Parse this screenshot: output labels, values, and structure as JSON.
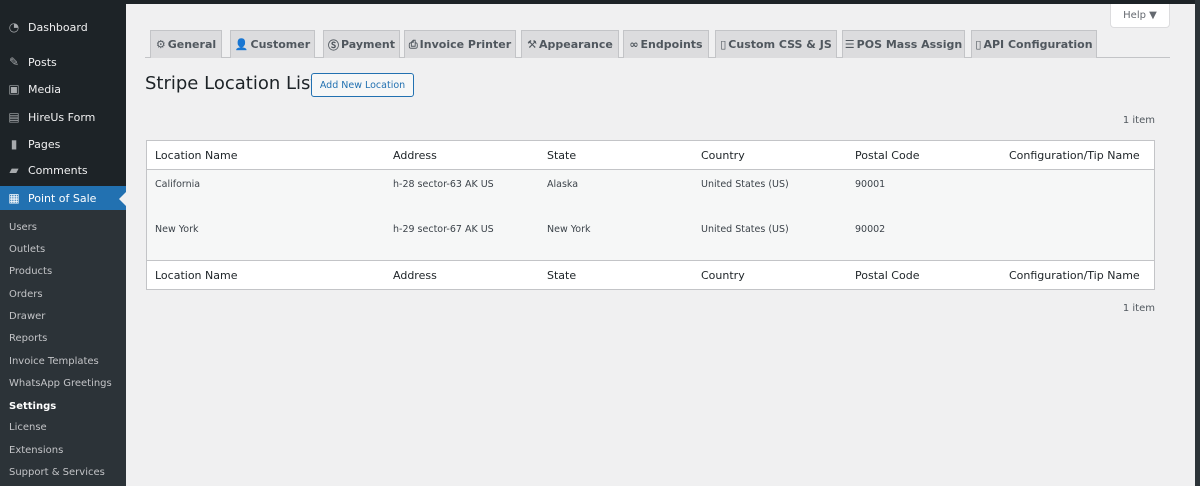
{
  "sidebar": {
    "items": [
      {
        "label": "Dashboard",
        "icon": "dashboard-icon"
      },
      {
        "label": "Posts",
        "icon": "pin-icon"
      },
      {
        "label": "Media",
        "icon": "media-icon"
      },
      {
        "label": "HireUs Form",
        "icon": "form-icon"
      },
      {
        "label": "Pages",
        "icon": "pages-icon"
      },
      {
        "label": "Comments",
        "icon": "comments-icon"
      },
      {
        "label": "Point of Sale",
        "icon": "calculator-icon"
      }
    ],
    "submenu": [
      "Users",
      "Outlets",
      "Products",
      "Orders",
      "Drawer",
      "Reports",
      "Invoice Templates",
      "WhatsApp Greetings",
      "Settings",
      "License",
      "Extensions",
      "Support & Services"
    ]
  },
  "help": "Help ▼",
  "tabs": [
    "General",
    "Customer",
    "Payment",
    "Invoice Printer",
    "Appearance",
    "Endpoints",
    "Custom CSS & JS",
    "POS Mass Assign",
    "API Configuration"
  ],
  "page": {
    "title": "Stripe Location List",
    "add_button": "Add New Location",
    "count": "1 item"
  },
  "table": {
    "columns": [
      "Location Name",
      "Address",
      "State",
      "Country",
      "Postal Code",
      "Configuration/Tip Name"
    ],
    "rows": [
      [
        "California",
        "h-28 sector-63 AK US",
        "Alaska",
        "United States (US)",
        "90001",
        ""
      ],
      [
        "New York",
        "h-29 sector-67 AK US",
        "New York",
        "United States (US)",
        "90002",
        ""
      ]
    ]
  }
}
